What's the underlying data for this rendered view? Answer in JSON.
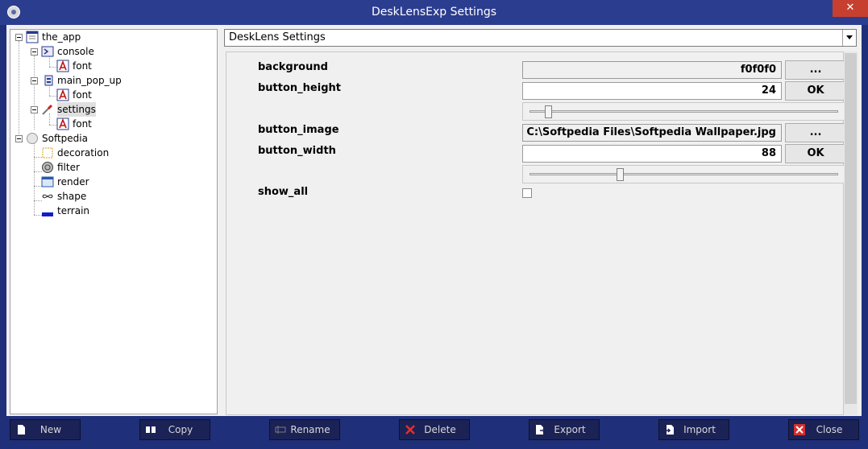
{
  "window": {
    "title": "DeskLensExp Settings",
    "close_label": "✕"
  },
  "tree": {
    "nodes": [
      {
        "label": "the_app",
        "icon": "window-icon"
      },
      {
        "label": "console",
        "icon": "console-icon"
      },
      {
        "label": "font",
        "icon": "font-icon"
      },
      {
        "label": "main_pop_up",
        "icon": "popup-icon"
      },
      {
        "label": "font",
        "icon": "font-icon"
      },
      {
        "label": "settings",
        "icon": "settings-wrench-icon"
      },
      {
        "label": "font",
        "icon": "font-icon"
      },
      {
        "label": "Softpedia",
        "icon": "circle-icon"
      },
      {
        "label": "decoration",
        "icon": "decoration-icon"
      },
      {
        "label": "filter",
        "icon": "filter-icon"
      },
      {
        "label": "render",
        "icon": "render-icon"
      },
      {
        "label": "shape",
        "icon": "shape-icon"
      },
      {
        "label": "terrain",
        "icon": "terrain-icon"
      }
    ]
  },
  "combo": {
    "value": "DeskLens Settings"
  },
  "props": {
    "background": {
      "label": "background",
      "value": "f0f0f0",
      "button": "..."
    },
    "button_height": {
      "label": "button_height",
      "value": "24",
      "button": "OK",
      "slider_fraction": 0.05
    },
    "button_image": {
      "label": "button_image",
      "value": "C:\\Softpedia Files\\Softpedia Wallpaper.jpg",
      "button": "..."
    },
    "button_width": {
      "label": "button_width",
      "value": "88",
      "button": "OK",
      "slider_fraction": 0.29
    },
    "show_all": {
      "label": "show_all",
      "checked": false
    }
  },
  "toolbar": {
    "new": "New",
    "copy": "Copy",
    "rename": "Rename",
    "delete": "Delete",
    "export": "Export",
    "import": "Import",
    "close": "Close"
  },
  "colors": {
    "frame": "#1f2f7a",
    "toolbar_button": "#1b2255",
    "close_button": "#c7402f"
  }
}
